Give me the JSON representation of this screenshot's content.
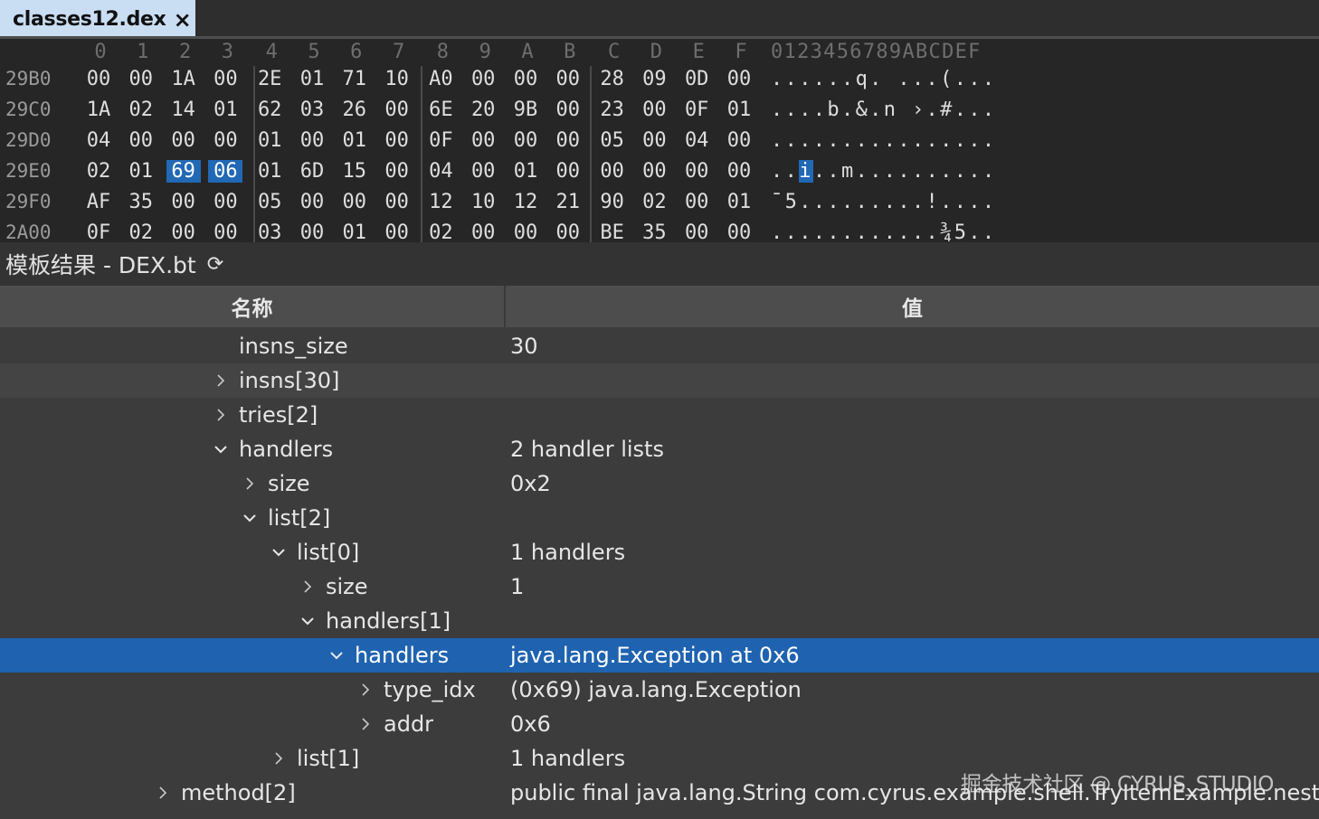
{
  "tab": {
    "title": "classes12.dex",
    "close_icon": "close-icon"
  },
  "hex": {
    "columns": [
      "0",
      "1",
      "2",
      "3",
      "4",
      "5",
      "6",
      "7",
      "8",
      "9",
      "A",
      "B",
      "C",
      "D",
      "E",
      "F"
    ],
    "ascii_header": "0123456789ABCDEF",
    "rows": [
      {
        "addr": "29B0",
        "bytes": [
          "00",
          "00",
          "1A",
          "00",
          "2E",
          "01",
          "71",
          "10",
          "A0",
          "00",
          "00",
          "00",
          "28",
          "09",
          "0D",
          "00"
        ],
        "ascii": "......q. ...(..."
      },
      {
        "addr": "29C0",
        "bytes": [
          "1A",
          "02",
          "14",
          "01",
          "62",
          "03",
          "26",
          "00",
          "6E",
          "20",
          "9B",
          "00",
          "23",
          "00",
          "0F",
          "01"
        ],
        "ascii": "....b.&.n ›.#..."
      },
      {
        "addr": "29D0",
        "bytes": [
          "04",
          "00",
          "00",
          "00",
          "01",
          "00",
          "01",
          "00",
          "0F",
          "00",
          "00",
          "00",
          "05",
          "00",
          "04",
          "00"
        ],
        "ascii": "................"
      },
      {
        "addr": "29E0",
        "bytes": [
          "02",
          "01",
          "69",
          "06",
          "01",
          "6D",
          "15",
          "00",
          "04",
          "00",
          "01",
          "00",
          "00",
          "00",
          "00",
          "00"
        ],
        "ascii": "..i..m.........."
      },
      {
        "addr": "29F0",
        "bytes": [
          "AF",
          "35",
          "00",
          "00",
          "05",
          "00",
          "00",
          "00",
          "12",
          "10",
          "12",
          "21",
          "90",
          "02",
          "00",
          "01"
        ],
        "ascii": "¯5.........!...."
      },
      {
        "addr": "2A00",
        "bytes": [
          "0F",
          "02",
          "00",
          "00",
          "03",
          "00",
          "01",
          "00",
          "02",
          "00",
          "00",
          "00",
          "BE",
          "35",
          "00",
          "00"
        ],
        "ascii": "............¾5.."
      }
    ],
    "selected": {
      "row": 3,
      "bytes": [
        2,
        3
      ],
      "ascii": [
        2,
        3
      ]
    },
    "selection_color": "#2168b5"
  },
  "panel": {
    "title": "模板结果 - DEX.bt",
    "refresh_icon": "refresh-icon"
  },
  "table": {
    "headers": {
      "name": "名称",
      "value": "值"
    },
    "rows": [
      {
        "name": "insns_size",
        "value": "30",
        "depth": 0,
        "toggle": "none"
      },
      {
        "name": "insns[30]",
        "value": "",
        "depth": 0,
        "toggle": "collapsed"
      },
      {
        "name": "tries[2]",
        "value": "",
        "depth": 0,
        "toggle": "collapsed"
      },
      {
        "name": "handlers",
        "value": "2 handler lists",
        "depth": 0,
        "toggle": "expanded"
      },
      {
        "name": "size",
        "value": "0x2",
        "depth": 1,
        "toggle": "collapsed"
      },
      {
        "name": "list[2]",
        "value": "",
        "depth": 1,
        "toggle": "expanded"
      },
      {
        "name": "list[0]",
        "value": "1 handlers",
        "depth": 2,
        "toggle": "expanded"
      },
      {
        "name": "size",
        "value": "1",
        "depth": 3,
        "toggle": "collapsed"
      },
      {
        "name": "handlers[1]",
        "value": "",
        "depth": 3,
        "toggle": "expanded"
      },
      {
        "name": "handlers",
        "value": "java.lang.Exception at 0x6",
        "depth": 4,
        "toggle": "expanded",
        "selected": true
      },
      {
        "name": "type_idx",
        "value": "(0x69) java.lang.Exception",
        "depth": 5,
        "toggle": "collapsed"
      },
      {
        "name": "addr",
        "value": "0x6",
        "depth": 5,
        "toggle": "collapsed"
      },
      {
        "name": "list[1]",
        "value": "1 handlers",
        "depth": 2,
        "toggle": "collapsed"
      },
      {
        "name": "method[2]",
        "value": "public final java.lang.String com.cyrus.example.shell.TryItemExample.nested...",
        "depth": -2,
        "toggle": "collapsed"
      }
    ]
  },
  "watermark": "掘金技术社区 @ CYRUS_STUDIO",
  "colors": {
    "tab_bg": "#c9ddf3",
    "hex_bg": "#262626",
    "row_selected": "#1f63b0",
    "row_alt": "#444444",
    "panel_bg": "#3c3c3c"
  }
}
